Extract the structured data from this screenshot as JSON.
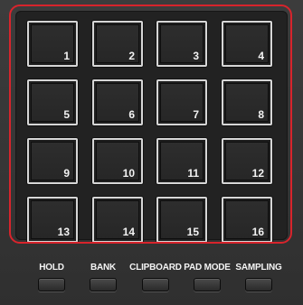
{
  "pads": [
    {
      "label": "1"
    },
    {
      "label": "2"
    },
    {
      "label": "3"
    },
    {
      "label": "4"
    },
    {
      "label": "5"
    },
    {
      "label": "6"
    },
    {
      "label": "7"
    },
    {
      "label": "8"
    },
    {
      "label": "9"
    },
    {
      "label": "10"
    },
    {
      "label": "11"
    },
    {
      "label": "12"
    },
    {
      "label": "13"
    },
    {
      "label": "14"
    },
    {
      "label": "15"
    },
    {
      "label": "16"
    }
  ],
  "buttons": [
    {
      "label": "HOLD"
    },
    {
      "label": "BANK"
    },
    {
      "label": "CLIPBOARD"
    },
    {
      "label": "PAD MODE"
    },
    {
      "label": "SAMPLING"
    }
  ],
  "colors": {
    "highlight_frame": "#d8242c",
    "panel": "#3a3a3a",
    "pad_border": "#d6d6d6"
  }
}
